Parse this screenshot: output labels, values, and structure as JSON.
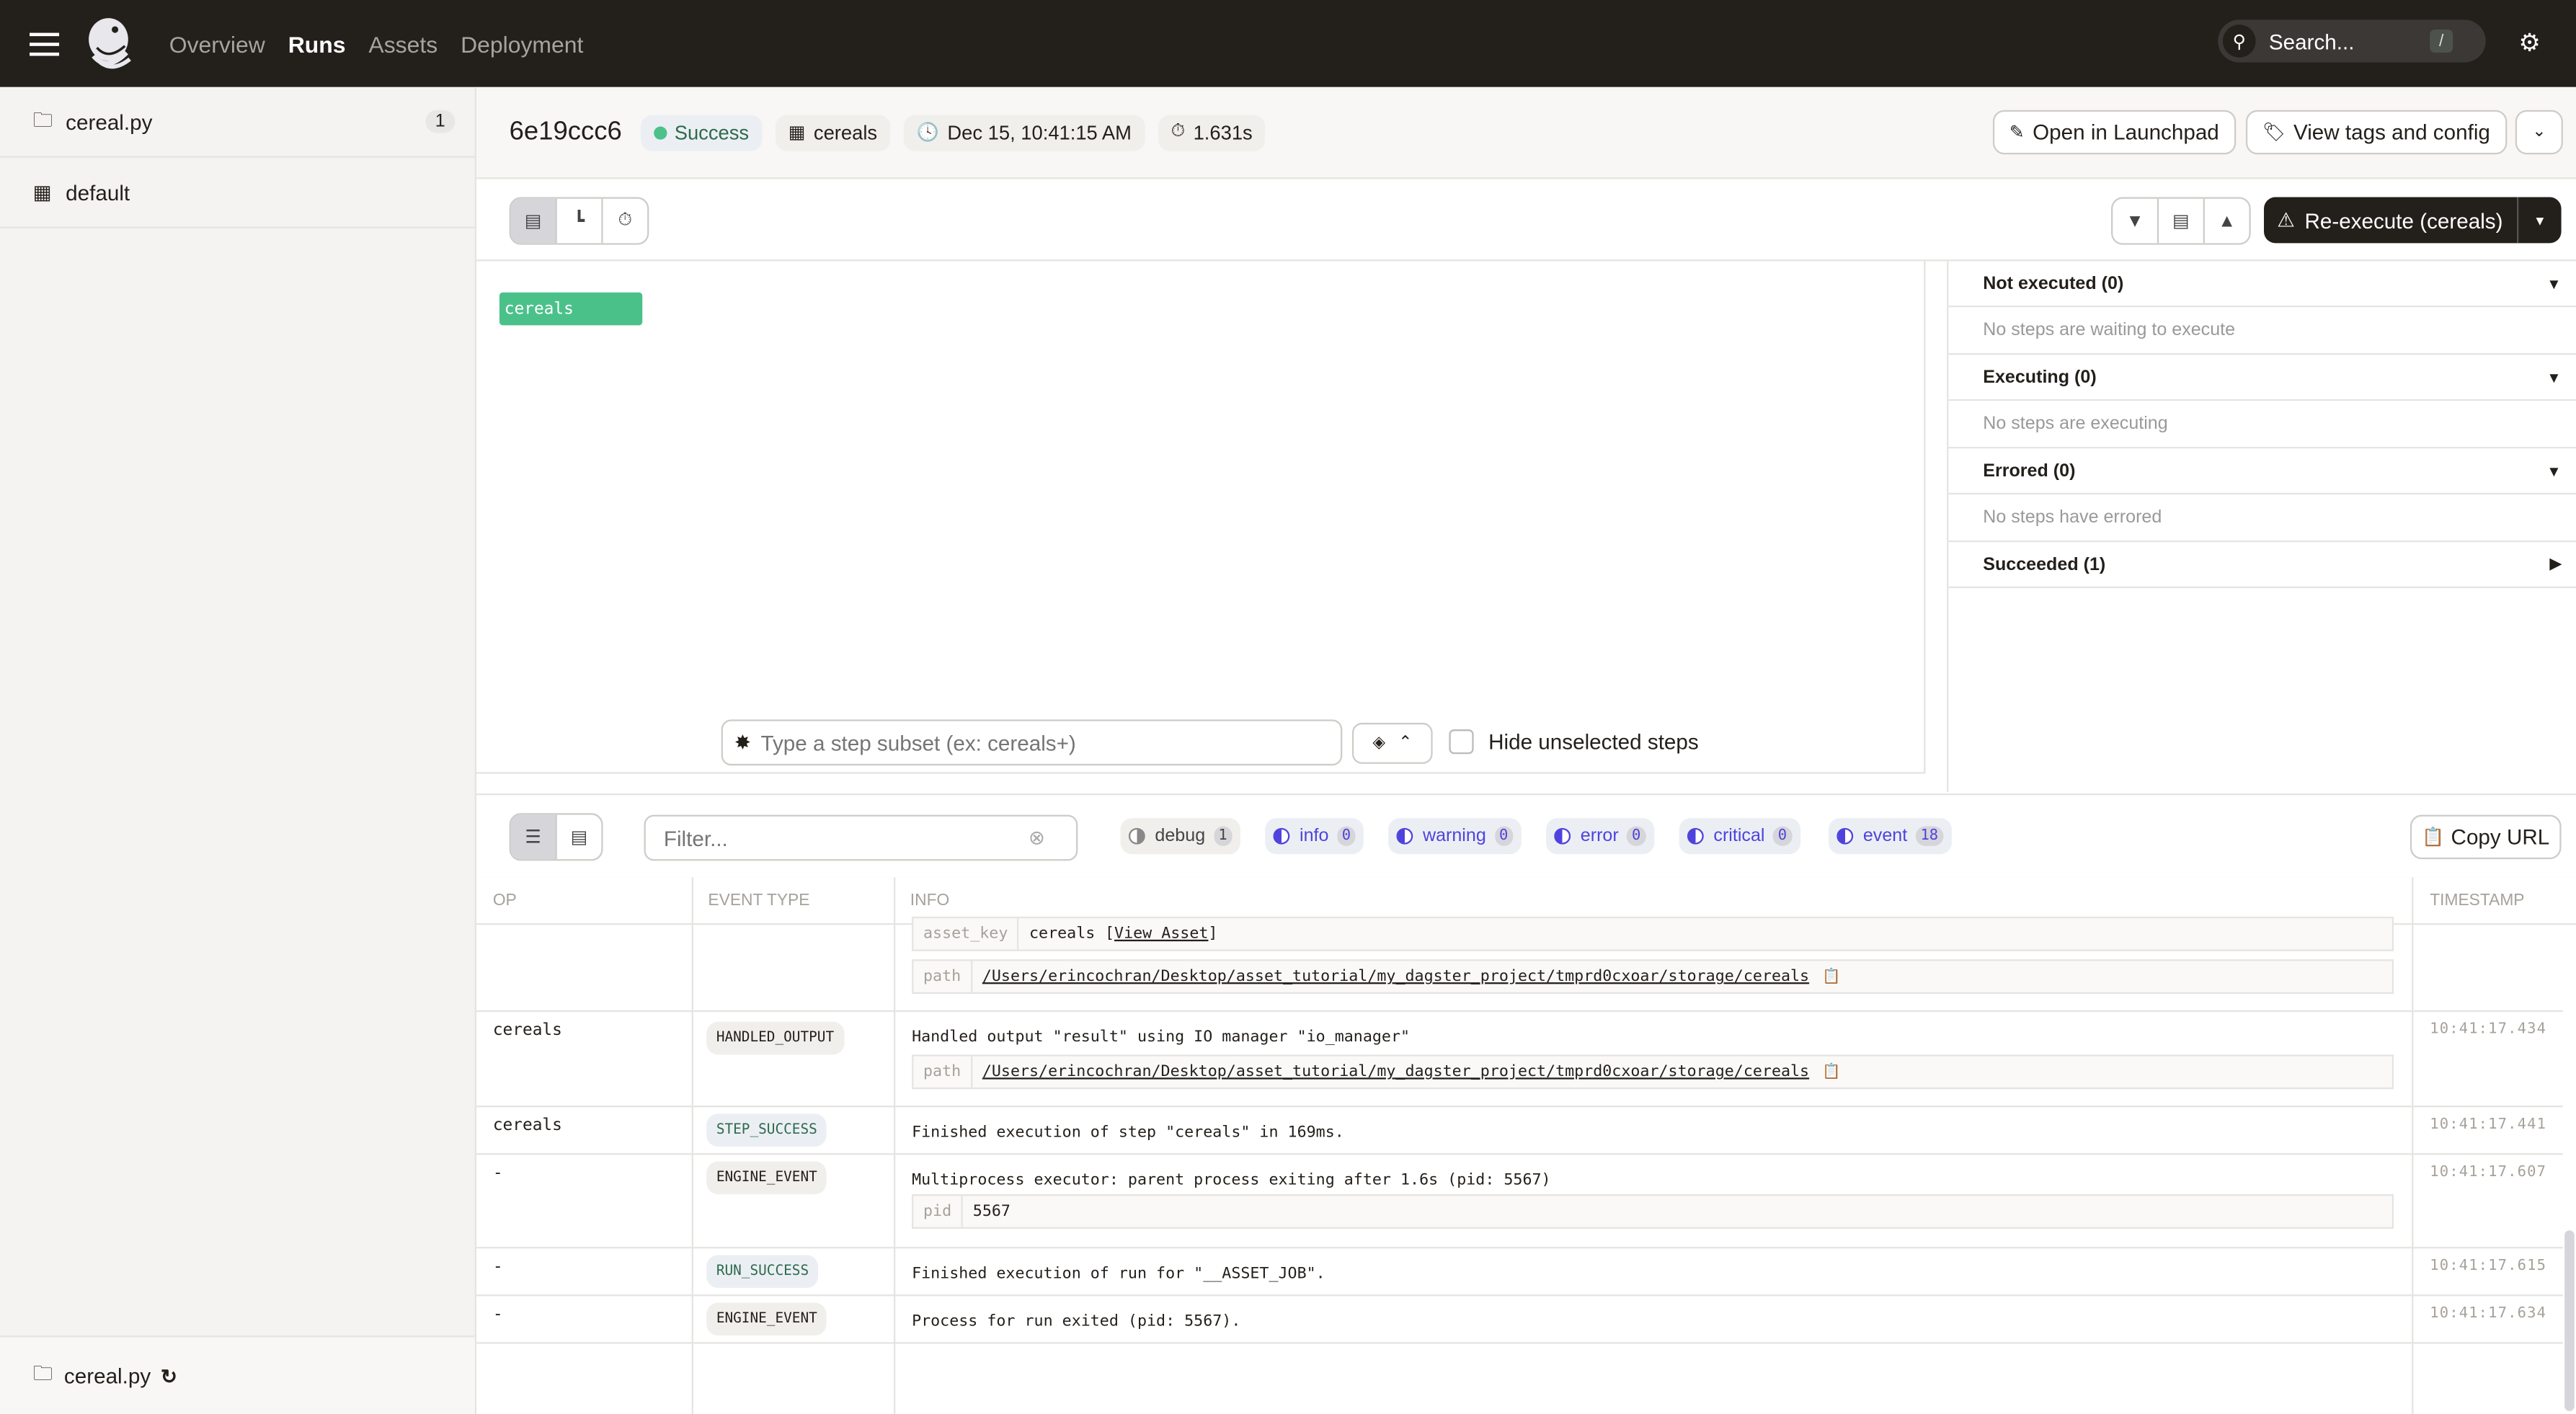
{
  "nav": {
    "links": [
      "Overview",
      "Runs",
      "Assets",
      "Deployment"
    ],
    "active": "Runs",
    "search_placeholder": "Search...",
    "search_shortcut": "/"
  },
  "sidebar": {
    "items": [
      {
        "label": "cereal.py",
        "icon": "folder-icon",
        "count": "1"
      },
      {
        "label": "default",
        "icon": "job-table-icon"
      }
    ],
    "footer_label": "cereal.py"
  },
  "run": {
    "id": "6e19ccc6",
    "status": "Success",
    "job": "cereals",
    "started": "Dec 15, 10:41:15 AM",
    "duration": "1.631s",
    "open_launchpad": "Open in Launchpad",
    "view_tags": "View tags and config",
    "reexecute": "Re-execute (cereals)"
  },
  "colors": {
    "success": "#4bc18a",
    "nav_bg": "#231f1b",
    "accent": "#4f43dd"
  },
  "gantt": {
    "steps": [
      {
        "name": "cereals",
        "status": "success"
      }
    ],
    "step_subset_placeholder": "Type a step subset (ex: cereals+)",
    "hide_unselected_label": "Hide unselected steps",
    "hide_unselected_checked": false
  },
  "step_panel": [
    {
      "title": "Not executed (0)",
      "expanded": true,
      "empty": "No steps are waiting to execute"
    },
    {
      "title": "Executing (0)",
      "expanded": true,
      "empty": "No steps are executing"
    },
    {
      "title": "Errored (0)",
      "expanded": true,
      "empty": "No steps have errored"
    },
    {
      "title": "Succeeded (1)",
      "expanded": false
    }
  ],
  "logs": {
    "filter_placeholder": "Filter...",
    "levels": [
      {
        "label": "debug",
        "count": "1",
        "enabled": false
      },
      {
        "label": "info",
        "count": "0",
        "enabled": true
      },
      {
        "label": "warning",
        "count": "0",
        "enabled": true
      },
      {
        "label": "error",
        "count": "0",
        "enabled": true
      },
      {
        "label": "critical",
        "count": "0",
        "enabled": true
      },
      {
        "label": "event",
        "count": "18",
        "enabled": true
      }
    ],
    "copy_url": "Copy URL",
    "columns": [
      "OP",
      "EVENT TYPE",
      "INFO",
      "TIMESTAMP"
    ],
    "partial_row": {
      "asset_key_label": "asset_key",
      "asset_key_value": "cereals",
      "view_asset": "View Asset",
      "path_label": "path",
      "path_value": "/Users/erincochran/Desktop/asset_tutorial/my_dagster_project/tmprd0cxoar/storage/cereals"
    },
    "rows": [
      {
        "op": "cereals",
        "type": "HANDLED_OUTPUT",
        "message": "Handled output \"result\" using IO manager \"io_manager\"",
        "kv_label": "path",
        "kv_value": "/Users/erincochran/Desktop/asset_tutorial/my_dagster_project/tmprd0cxoar/storage/cereals",
        "timestamp": "10:41:17.434"
      },
      {
        "op": "cereals",
        "type": "STEP_SUCCESS",
        "message": "Finished execution of step \"cereals\" in 169ms.",
        "timestamp": "10:41:17.441"
      },
      {
        "op": "-",
        "type": "ENGINE_EVENT",
        "message": "Multiprocess executor: parent process exiting after 1.6s (pid: 5567)",
        "kv_label": "pid",
        "kv_value": "5567",
        "timestamp": "10:41:17.607"
      },
      {
        "op": "-",
        "type": "RUN_SUCCESS",
        "message": "Finished execution of run for \"__ASSET_JOB\".",
        "timestamp": "10:41:17.615"
      },
      {
        "op": "-",
        "type": "ENGINE_EVENT",
        "message": "Process for run exited (pid: 5567).",
        "timestamp": "10:41:17.634"
      }
    ]
  }
}
